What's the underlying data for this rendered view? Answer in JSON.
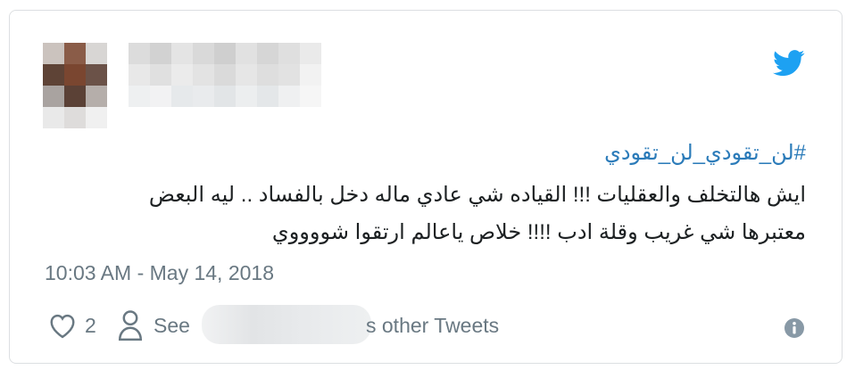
{
  "tweet": {
    "hashtag": "#لن_تقودي_لن_تقودي",
    "line1": "ايش هالتخلف والعقليات !!! القياده شي عادي ماله دخل بالفساد .. ليه البعض",
    "line2": "معتبرها شي غريب وقلة ادب !!!! خلاص ياعالم ارتقوا شووووي",
    "timestamp": "10:03 AM - May 14, 2018"
  },
  "actions": {
    "like_count": "2",
    "see_label": "See",
    "other_tweets_label": "s other Tweets"
  },
  "icons": {
    "brand": "twitter-bird-icon",
    "like": "heart-icon",
    "profile": "person-icon",
    "info": "info-icon"
  },
  "colors": {
    "brand_blue": "#1da1f2",
    "link_blue": "#2b7bb9",
    "text": "#1c2022",
    "muted": "#697882",
    "border": "#dcdfe2"
  }
}
